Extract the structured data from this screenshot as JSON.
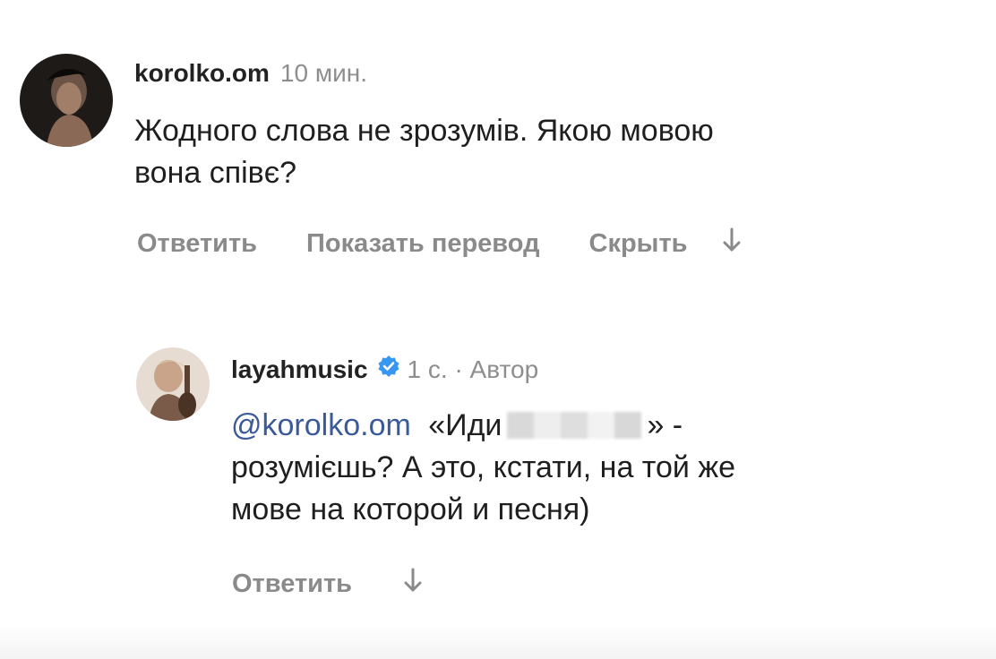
{
  "comments": [
    {
      "username": "korolko.om",
      "time": "10 мин.",
      "text_lines": [
        "Жодного слова не зрозумів. Якою мовою",
        "вона співє?"
      ],
      "actions": {
        "reply": "Ответить",
        "translate": "Показать перевод",
        "hide": "Скрыть"
      },
      "icon": "arrow-down-icon"
    },
    {
      "username": "layahmusic",
      "verified_icon": "verified-badge-icon",
      "time": "1 с. · Автор",
      "mention": "@korolko.om",
      "text_part1": "«Иди",
      "text_part2": "» -",
      "text_line2": "розумієшь? А это, кстати, на той же",
      "text_line3": "мове на которой и песня)",
      "actions": {
        "reply": "Ответить"
      },
      "icon": "arrow-down-icon"
    }
  ],
  "colors": {
    "mention": "#3b5a9a",
    "verified": "#3897f0",
    "muted": "#8a8a8a"
  }
}
